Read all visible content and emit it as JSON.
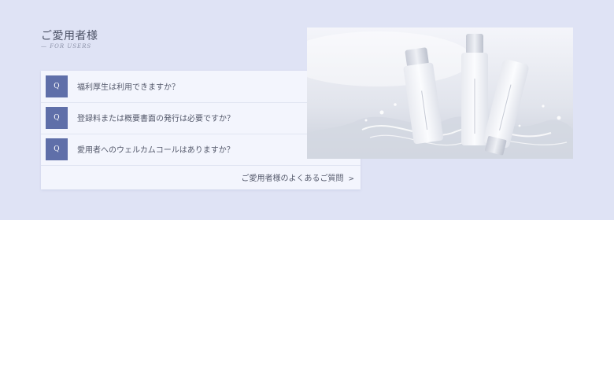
{
  "section": {
    "title": "ご愛用者様",
    "subtitle": "— FOR USERS"
  },
  "faq": {
    "badge": "Q",
    "items": [
      {
        "question": "福利厚生は利用できますか？"
      },
      {
        "question": "登録料または概要書面の発行は必要ですか？"
      },
      {
        "question": "愛用者へのウェルカムコールはありますか？"
      }
    ],
    "more_link": "ご愛用者様のよくあるご質問",
    "more_icon": "chevron-right-icon"
  },
  "product_image": {
    "description_icon": "product-photo",
    "colors": {
      "bg_top": "#f1f3f9",
      "bg_bottom": "#c9ced9",
      "bottle": "#f7f8fb",
      "cap": "#d7dae3"
    }
  }
}
